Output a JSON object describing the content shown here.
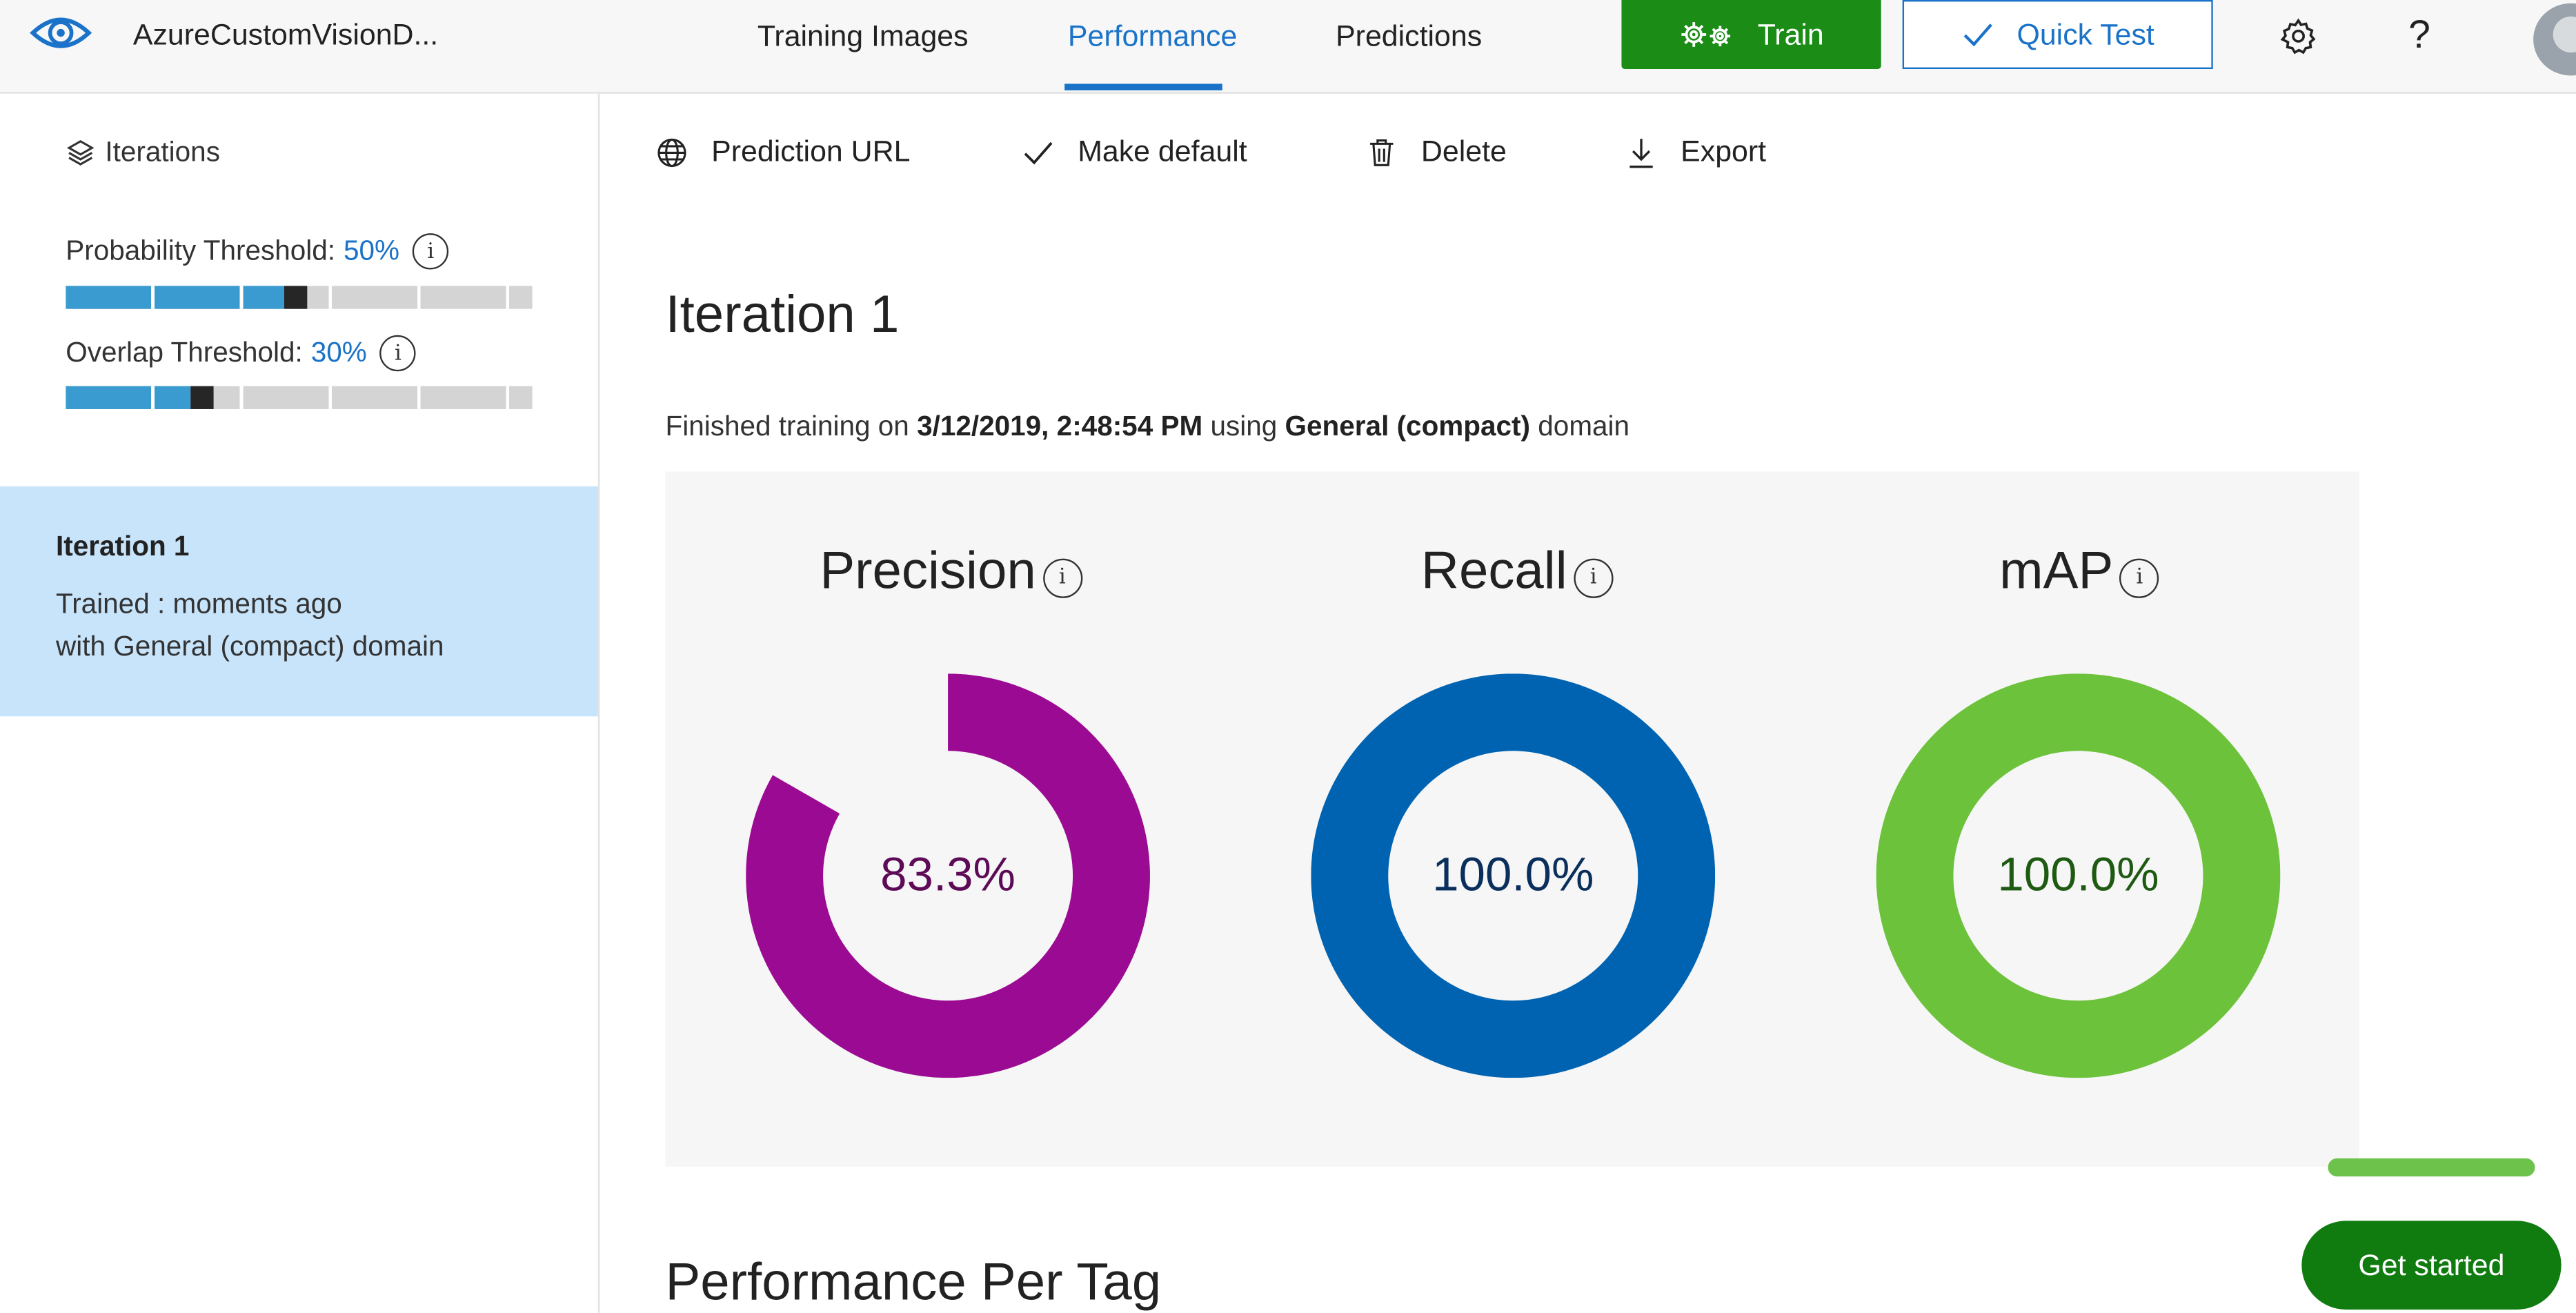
{
  "header": {
    "app_title": "AzureCustomVisionD...",
    "tabs": [
      {
        "label": "Training Images"
      },
      {
        "label": "Performance"
      },
      {
        "label": "Predictions"
      }
    ],
    "active_tab": "Performance",
    "train_label": "Train",
    "quick_test_label": "Quick Test",
    "help_label": "?",
    "accent_color": "#1a73c8",
    "train_color": "#1b8d17"
  },
  "sidebar": {
    "iterations_label": "Iterations",
    "probability": {
      "label": "Probability Threshold:",
      "value": "50%",
      "fraction": 0.5
    },
    "overlap": {
      "label": "Overlap Threshold:",
      "value": "30%",
      "fraction": 0.3
    },
    "selected_iteration": {
      "title": "Iteration 1",
      "trained": "Trained : moments ago",
      "domain": "with General (compact) domain"
    }
  },
  "toolbar": {
    "prediction_url": "Prediction URL",
    "make_default": "Make default",
    "delete": "Delete",
    "export": "Export"
  },
  "main": {
    "iteration_title": "Iteration 1",
    "finished_prefix": "Finished training on",
    "finished_date": "3/12/2019, 2:48:54 PM",
    "finished_using": "using",
    "finished_domain": "General (compact)",
    "finished_suffix": "domain",
    "info_glyph": "i",
    "metrics": [
      {
        "name": "Precision",
        "value_text": "83.3%",
        "fraction": 0.833,
        "color": "#9b0a92",
        "text_color": "#5d0a57"
      },
      {
        "name": "Recall",
        "value_text": "100.0%",
        "fraction": 1.0,
        "color": "#0063b1",
        "text_color": "#0a2f5c"
      },
      {
        "name": "mAP",
        "value_text": "100.0%",
        "fraction": 1.0,
        "color": "#6cc23a",
        "text_color": "#1f5a12"
      }
    ],
    "perf_per_tag": "Performance Per Tag"
  },
  "get_started_label": "Get started"
}
